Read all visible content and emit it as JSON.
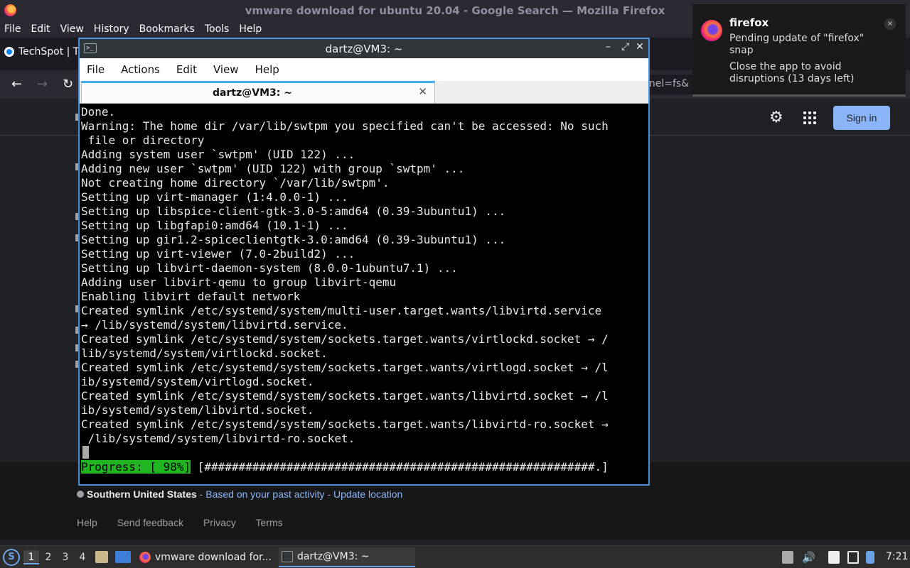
{
  "firefox": {
    "window_title": "vmware download for ubuntu 20.04 - Google Search — Mozilla Firefox",
    "menu": [
      "File",
      "Edit",
      "View",
      "History",
      "Bookmarks",
      "Tools",
      "Help"
    ],
    "tab_label": "TechSpot | T",
    "url_fragment": "nnel=fs&",
    "sign_in": "Sign in",
    "location": {
      "place": "Southern United States",
      "sep1": " - ",
      "based_on": "Based on your past activity",
      "sep2": " - ",
      "update": "Update location"
    },
    "footer_links": [
      "Help",
      "Send feedback",
      "Privacy",
      "Terms"
    ]
  },
  "terminal": {
    "title": "dartz@VM3: ~",
    "menu": [
      "File",
      "Actions",
      "Edit",
      "View",
      "Help"
    ],
    "tab_label": "dartz@VM3: ~",
    "lines": [
      "Done.",
      "Warning: The home dir /var/lib/swtpm you specified can't be accessed: No such",
      " file or directory",
      "Adding system user `swtpm' (UID 122) ...",
      "Adding new user `swtpm' (UID 122) with group `swtpm' ...",
      "Not creating home directory `/var/lib/swtpm'.",
      "Setting up virt-manager (1:4.0.0-1) ...",
      "Setting up libspice-client-gtk-3.0-5:amd64 (0.39-3ubuntu1) ...",
      "Setting up libgfapi0:amd64 (10.1-1) ...",
      "Setting up gir1.2-spiceclientgtk-3.0:amd64 (0.39-3ubuntu1) ...",
      "Setting up virt-viewer (7.0-2build2) ...",
      "Setting up libvirt-daemon-system (8.0.0-1ubuntu7.1) ...",
      "Adding user libvirt-qemu to group libvirt-qemu",
      "Enabling libvirt default network",
      "Created symlink /etc/systemd/system/multi-user.target.wants/libvirtd.service",
      "→ /lib/systemd/system/libvirtd.service.",
      "Created symlink /etc/systemd/system/sockets.target.wants/virtlockd.socket → /",
      "lib/systemd/system/virtlockd.socket.",
      "Created symlink /etc/systemd/system/sockets.target.wants/virtlogd.socket → /l",
      "ib/systemd/system/virtlogd.socket.",
      "Created symlink /etc/systemd/system/sockets.target.wants/libvirtd.socket → /l",
      "ib/systemd/system/libvirtd.socket.",
      "Created symlink /etc/systemd/system/sockets.target.wants/libvirtd-ro.socket →",
      " /lib/systemd/system/libvirtd-ro.socket."
    ],
    "progress_label": "Progress: [ 98%]",
    "progress_bar": " [#########################################################.]",
    "progress_value": 98
  },
  "notification": {
    "app": "firefox",
    "message": "Pending update of \"firefox\" snap",
    "detail": "Close the app to avoid disruptions (13 days left)",
    "close_glyph": "×"
  },
  "taskbar": {
    "workspaces": [
      "1",
      "2",
      "3",
      "4"
    ],
    "active_workspace": "1",
    "tasks": [
      "vmware download for...",
      "dartz@VM3: ~"
    ],
    "clock": "7:21"
  },
  "colors": {
    "terminal_border": "#4a90d9",
    "progress_green": "#22b522",
    "signin_blue": "#8ab4f8"
  }
}
